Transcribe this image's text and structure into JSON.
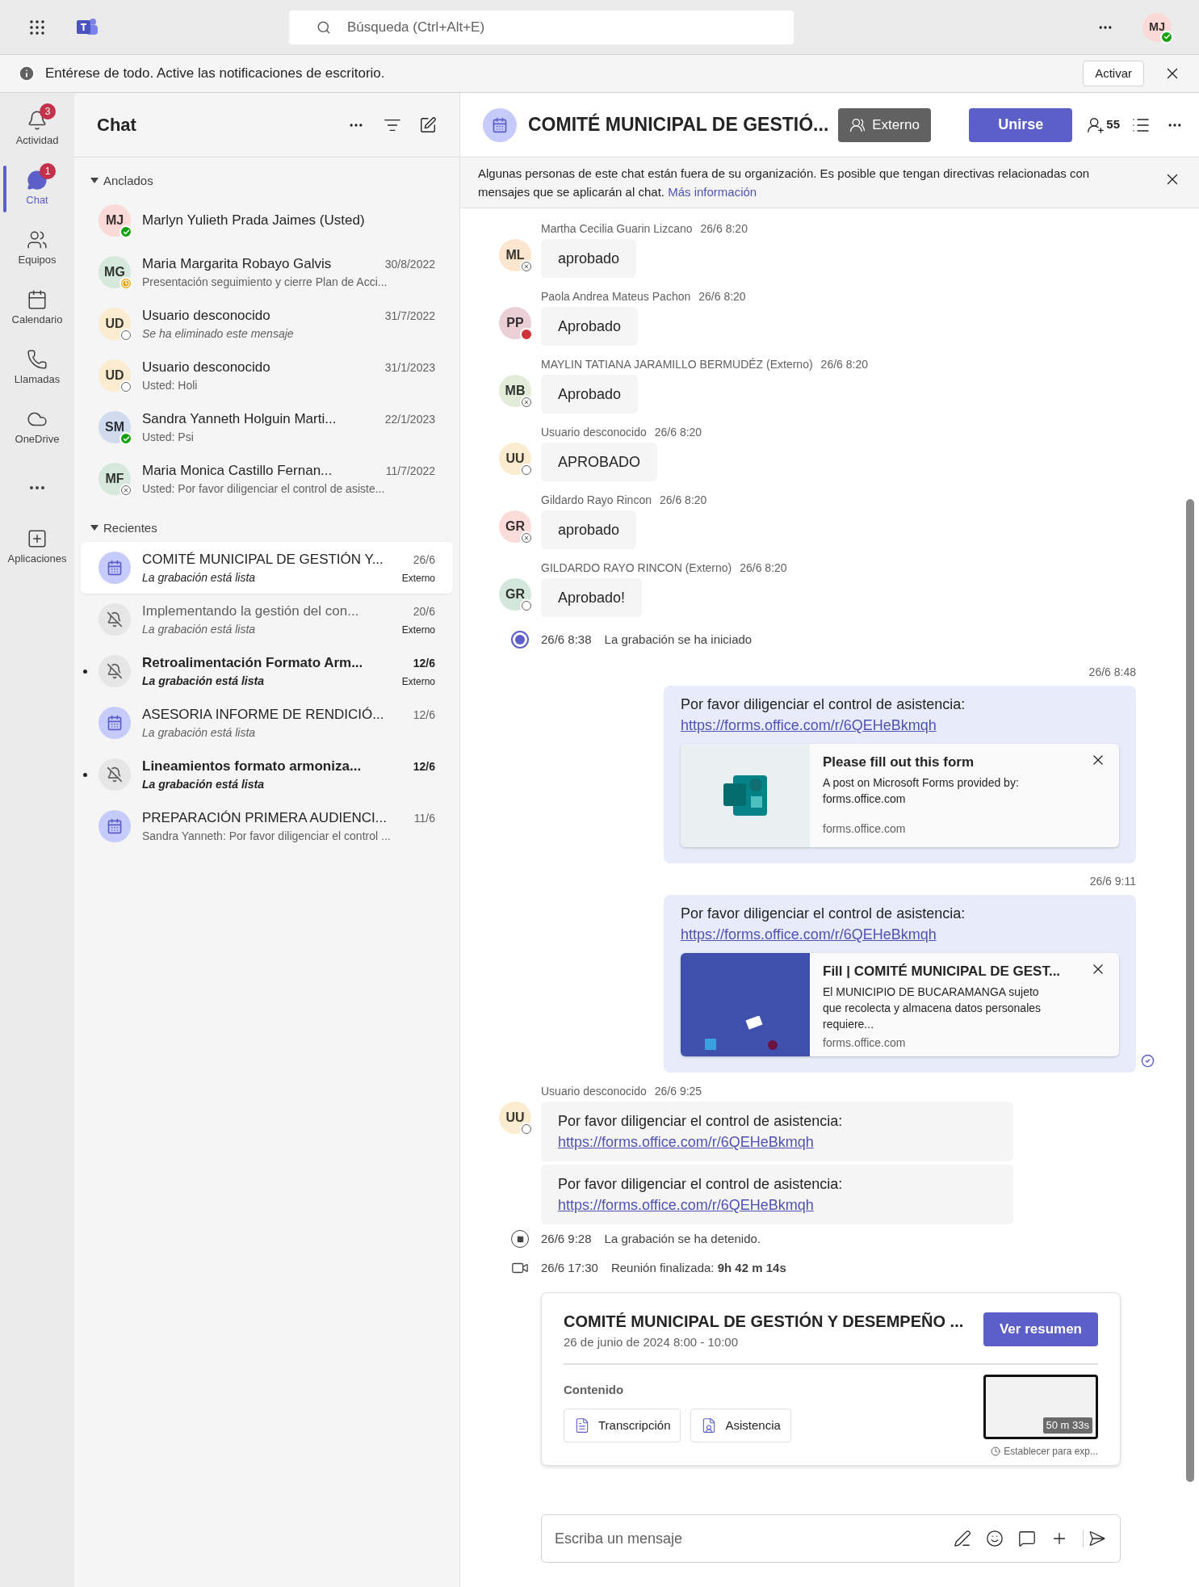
{
  "top_bar": {
    "search_placeholder": "Búsqueda (Ctrl+Alt+E)",
    "avatar": {
      "initials": "MJ",
      "color": "#fbd9d6",
      "presence": {
        "kind": "available"
      }
    }
  },
  "notice": {
    "text": "Entérese de todo. Active las notificaciones de escritorio.",
    "button": "Activar"
  },
  "rail": [
    {
      "kind": "activity",
      "label": "Actividad",
      "badge": "3",
      "selected": false
    },
    {
      "kind": "chat",
      "label": "Chat",
      "badge": "1",
      "selected": true
    },
    {
      "kind": "teams",
      "label": "Equipos",
      "selected": false
    },
    {
      "kind": "calendar",
      "label": "Calendario",
      "selected": false
    },
    {
      "kind": "calls",
      "label": "Llamadas",
      "selected": false
    },
    {
      "kind": "onedrive",
      "label": "OneDrive",
      "selected": false
    },
    {
      "kind": "more",
      "selected": false
    },
    {
      "kind": "apps",
      "label": "Aplicaciones",
      "selected": false
    }
  ],
  "chat_list": {
    "title": "Chat",
    "sections": [
      {
        "title": "Anclados",
        "expanded": true,
        "chats": [
          {
            "kind": "person",
            "initials": "MJ",
            "color": "#fbd9d6",
            "presence": {
              "kind": "available"
            },
            "name": "Marlyn Yulieth Prada Jaimes (Usted)",
            "unread": false,
            "selected": false
          },
          {
            "kind": "person",
            "initials": "MG",
            "color": "#d6e8dc",
            "presence": {
              "kind": "away"
            },
            "name": "Maria Margarita Robayo Galvis",
            "date": "30/8/2022",
            "preview": "Presentación seguimiento y cierre Plan de Acci...",
            "italic": false,
            "unread": false,
            "selected": false
          },
          {
            "kind": "person",
            "initials": "UD",
            "color": "#fbecd0",
            "presence": {
              "kind": "offline"
            },
            "name": "Usuario desconocido",
            "date": "31/7/2022",
            "preview": "Se ha eliminado este mensaje",
            "italic": true,
            "unread": false,
            "selected": false
          },
          {
            "kind": "person",
            "initials": "UD",
            "color": "#fbecd0",
            "presence": {
              "kind": "offline"
            },
            "name": "Usuario desconocido",
            "date": "31/1/2023",
            "preview": "Usted: Holi",
            "italic": false,
            "unread": false,
            "selected": false
          },
          {
            "kind": "person",
            "initials": "SM",
            "color": "#d0dbef",
            "presence": {
              "kind": "available"
            },
            "name": "Sandra Yanneth Holguin Marti...",
            "date": "22/1/2023",
            "preview": "Usted: Psi",
            "italic": false,
            "unread": false,
            "selected": false
          },
          {
            "kind": "person",
            "initials": "MF",
            "color": "#d6e8dc",
            "presence": {
              "kind": "unknown"
            },
            "name": "Maria Monica Castillo Fernan...",
            "date": "11/7/2022",
            "preview": "Usted: Por favor diligenciar el control de asiste...",
            "italic": false,
            "unread": false,
            "selected": false
          }
        ]
      },
      {
        "title": "Recientes",
        "expanded": true,
        "chats": [
          {
            "kind": "meeting",
            "name": "COMITÉ MUNICIPAL DE GESTIÓN Y...",
            "date": "26/6",
            "preview": "La grabación está lista",
            "italic": true,
            "tag": "Externo",
            "unread": false,
            "selected": true
          },
          {
            "kind": "muted",
            "name": "Implementando la gestión del con...",
            "date": "20/6",
            "preview": "La grabación está lista",
            "italic": true,
            "tag": "Externo",
            "unread": false,
            "selected": false
          },
          {
            "kind": "muted",
            "name": "Retroalimentación Formato Arm...",
            "date": "12/6",
            "preview": "La grabación está lista",
            "italic": true,
            "tag": "Externo",
            "unread": true,
            "selected": false
          },
          {
            "kind": "meeting",
            "name": "ASESORIA INFORME DE RENDICIÓ...",
            "date": "12/6",
            "preview": "La grabación está lista",
            "italic": true,
            "unread": false,
            "selected": false
          },
          {
            "kind": "muted",
            "name": "Lineamientos formato armoniza...",
            "date": "12/6",
            "preview": "La grabación está lista",
            "italic": true,
            "unread": true,
            "selected": false
          },
          {
            "kind": "meeting",
            "name": "PREPARACIÓN PRIMERA AUDIENCI...",
            "date": "11/6",
            "preview": "Sandra Yanneth: Por favor diligenciar el control ...",
            "italic": false,
            "unread": false,
            "selected": false
          }
        ]
      }
    ]
  },
  "conversation": {
    "title": "COMITÉ MUNICIPAL DE GESTIÓ...",
    "tag": "Externo",
    "join_button": "Unirse",
    "participants": "55",
    "banner": {
      "text": "Algunas personas de este chat están fuera de su organización. Es posible que tengan directivas relacionadas con mensajes que se aplicarán al chat.",
      "link": "Más información"
    },
    "messages": [
      {
        "kind": "incoming",
        "sender": "Martha Cecilia Guarin Lizcano",
        "time": "26/6 8:20",
        "initials": "ML",
        "color": "#fce6cf",
        "presence": {
          "kind": "unknown"
        },
        "bubbles": [
          {
            "text": "aprobado"
          }
        ]
      },
      {
        "kind": "incoming",
        "sender": "Paola Andrea Mateus Pachon",
        "time": "26/6 8:20",
        "initials": "PP",
        "color": "#ead0d6",
        "presence": {
          "kind": "busy"
        },
        "bubbles": [
          {
            "text": "Aprobado"
          }
        ]
      },
      {
        "kind": "incoming",
        "sender": "MAYLIN TATIANA JARAMILLO BERMUDÉZ (Externo)",
        "time": "26/6 8:20",
        "initials": "MB",
        "color": "#e2ecd9",
        "presence": {
          "kind": "unknown"
        },
        "bubbles": [
          {
            "text": "Aprobado"
          }
        ]
      },
      {
        "kind": "incoming",
        "sender": "Usuario desconocido",
        "time": "26/6 8:20",
        "initials": "UU",
        "color": "#fbecd0",
        "presence": {
          "kind": "offline"
        },
        "bubbles": [
          {
            "text": "APROBADO"
          }
        ]
      },
      {
        "kind": "incoming",
        "sender": "Gildardo Rayo Rincon",
        "time": "26/6 8:20",
        "initials": "GR",
        "color": "#fbdcd8",
        "presence": {
          "kind": "unknown"
        },
        "bubbles": [
          {
            "text": "aprobado"
          }
        ]
      },
      {
        "kind": "incoming",
        "sender": "GILDARDO RAYO RINCON (Externo)",
        "time": "26/6 8:20",
        "initials": "GR",
        "color": "#d3e7dc",
        "presence": {
          "kind": "offline"
        },
        "bubbles": [
          {
            "text": "Aprobado!"
          }
        ]
      },
      {
        "kind": "recording_start",
        "time": "26/6 8:38",
        "text": "La grabación se ha iniciado"
      },
      {
        "kind": "outgoing",
        "time": "26/6 8:48",
        "text": "Por favor diligenciar el control de asistencia:",
        "link": "https://forms.office.com/r/6QEHeBkmqh",
        "read": false,
        "preview": {
          "kind": "forms_logo",
          "title": "Please fill out this form",
          "description": "A post on Microsoft Forms provided by: forms.office.com",
          "site": "forms.office.com"
        }
      },
      {
        "kind": "outgoing",
        "time": "26/6 9:11",
        "text": "Por favor diligenciar el control de asistencia:",
        "link": "https://forms.office.com/r/6QEHeBkmqh",
        "read": true,
        "preview": {
          "kind": "banner",
          "title": "Fill | COMITÉ MUNICIPAL DE GEST...",
          "description": "El MUNICIPIO DE BUCARAMANGA sujeto que recolecta y almacena datos personales requiere...",
          "site": "forms.office.com"
        }
      },
      {
        "kind": "incoming",
        "sender": "Usuario desconocido",
        "time": "26/6 9:25",
        "initials": "UU",
        "color": "#fbecd0",
        "presence": {
          "kind": "offline"
        },
        "bubbles": [
          {
            "text": "Por favor diligenciar el control de asistencia:",
            "link": "https://forms.office.com/r/6QEHeBkmqh"
          },
          {
            "text": "Por favor diligenciar el control de asistencia:",
            "link": "https://forms.office.com/r/6QEHeBkmqh"
          }
        ]
      },
      {
        "kind": "recording_stop",
        "time": "26/6 9:28",
        "text": "La grabación se ha detenido."
      },
      {
        "kind": "meeting_end",
        "time": "26/6 17:30",
        "text": "Reunión finalizada: **9h 42 m 14s**"
      },
      {
        "kind": "meeting_card",
        "title": "COMITÉ MUNICIPAL DE GESTIÓN Y DESEMPEÑO ...",
        "date": "26 de junio de 2024 8:00 - 10:00",
        "button": "Ver resumen",
        "content_label": "Contenido",
        "files": [
          {
            "kind": "transcript",
            "label": "Transcripción"
          },
          {
            "kind": "attendance",
            "label": "Asistencia"
          }
        ],
        "duration": "50 m 33s",
        "expiry": "Establecer para exp..."
      }
    ],
    "composer": {
      "placeholder": "Escriba un mensaje"
    }
  }
}
